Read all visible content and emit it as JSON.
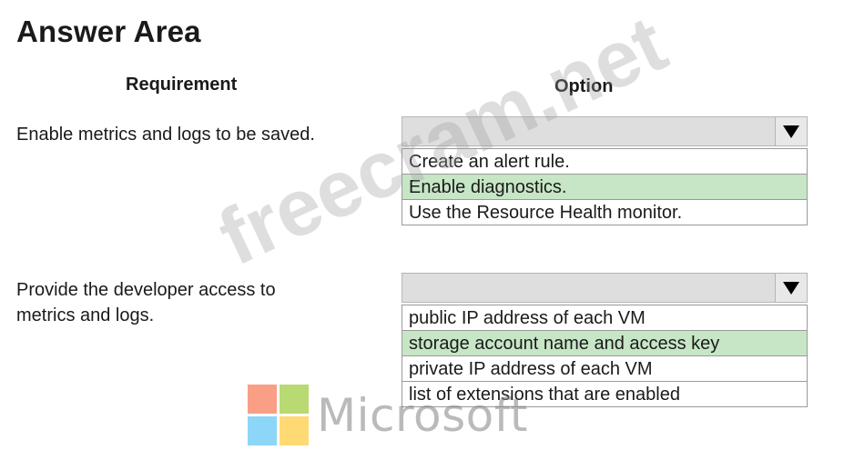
{
  "title": "Answer Area",
  "headers": {
    "requirement": "Requirement",
    "option": "Option"
  },
  "rows": [
    {
      "requirement": "Enable metrics and logs to be saved.",
      "options": [
        "Create an alert rule.",
        "Enable diagnostics.",
        "Use the Resource Health monitor."
      ],
      "selected_index": 1
    },
    {
      "requirement_line1": "Provide the developer access to",
      "requirement_line2": "metrics and logs.",
      "options": [
        "public IP address of each VM",
        "storage account name and access key",
        "private IP address of each VM",
        "list of extensions that are enabled"
      ],
      "selected_index": 1
    }
  ],
  "watermark": "freecram.net",
  "logo": {
    "word": "Microsoft",
    "colors": {
      "red": "#f25022",
      "green": "#7fba00",
      "blue": "#00a4ef",
      "yellow": "#ffb900"
    }
  },
  "colors": {
    "selected": "#c6e6c6",
    "dropdown_head": "#dedede"
  },
  "icons": {
    "dropdown_arrow": "triangle-down-icon"
  }
}
